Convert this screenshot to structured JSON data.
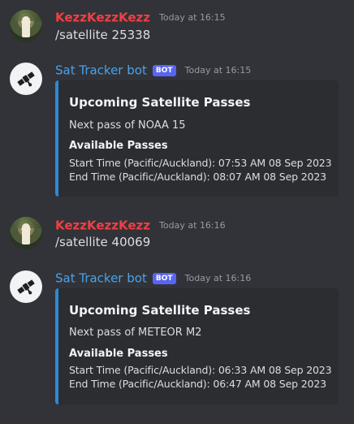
{
  "messages": [
    {
      "author": "KezzKezzKezz",
      "timestamp": "Today at 16:15",
      "text": "/satellite 25338"
    },
    {
      "author": "Sat Tracker bot",
      "badge": "BOT",
      "timestamp": "Today at 16:15",
      "embed": {
        "title": "Upcoming Satellite Passes",
        "description": "Next pass of NOAA 15",
        "field_name": "Available Passes",
        "start": "Start Time (Pacific/Auckland): 07:53 AM 08 Sep 2023",
        "end": "End Time (Pacific/Auckland): 08:07 AM 08 Sep 2023"
      }
    },
    {
      "author": "KezzKezzKezz",
      "timestamp": "Today at 16:16",
      "text": "/satellite 40069"
    },
    {
      "author": "Sat Tracker bot",
      "badge": "BOT",
      "timestamp": "Today at 16:16",
      "embed": {
        "title": "Upcoming Satellite Passes",
        "description": "Next pass of METEOR M2",
        "field_name": "Available Passes",
        "start": "Start Time (Pacific/Auckland): 06:33 AM 08 Sep 2023",
        "end": "End Time (Pacific/Auckland): 06:47 AM 08 Sep 2023"
      }
    }
  ],
  "colors": {
    "background": "#313338",
    "user_name": "#f23f43",
    "bot_name": "#4aa3e9",
    "bot_badge": "#5865f2",
    "embed_bg": "#2b2d31",
    "embed_accent": "#2b8ad8"
  },
  "icons": {
    "user_avatar": "user-avatar-photo",
    "bot_avatar": "satellite-icon"
  }
}
